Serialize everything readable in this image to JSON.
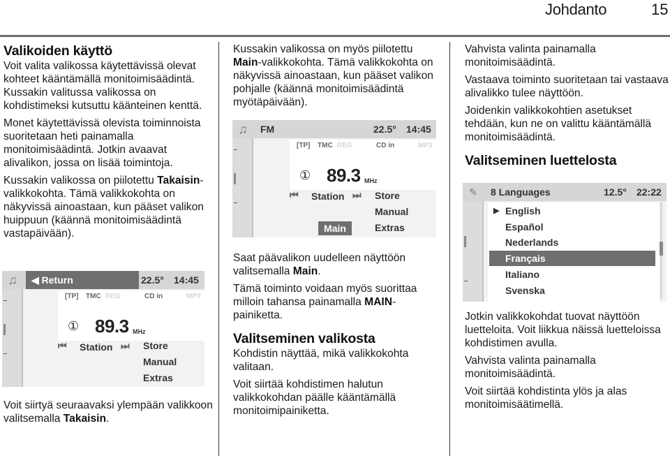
{
  "header": {
    "section": "Johdanto",
    "page_number": "15"
  },
  "col1": {
    "heading": "Valikoiden käyttö",
    "p1": "Voit valita valikossa käytettävissä olevat kohteet kääntämällä monitoimisäädintä. Kussakin valitussa valikossa on kohdistimeksi kutsuttu käänteinen kenttä.",
    "p2": "Monet käytettävissä olevista toiminnoista suoritetaan heti painamalla monitoimisäädintä. Jotkin avaavat alivalikon, jossa on lisää toimintoja.",
    "p3_pre": "Kussakin valikossa on piilotettu ",
    "p3_bold": "Takaisin",
    "p3_post": "-valikkokohta. Tämä valikkokohta on näkyvissä ainoastaan, kun pääset valikon huippuun (käännä monitoimisäädintä vastapäivään).",
    "p4_pre": "Voit siirtyä seuraavaksi ylempään valikkoon valitsemalla ",
    "p4_bold": "Takaisin",
    "p4_post": "."
  },
  "screen1": {
    "icon": "music-note-icon",
    "title": "◀ Return",
    "temperature": "22.5°",
    "time": "14:45",
    "indicators": [
      "[TP]",
      "TMC",
      "REG",
      "CD in",
      "MP3"
    ],
    "preset": "①",
    "frequency": "89.3",
    "unit": "MHz",
    "prev_glyph": "⏮",
    "station": "Station",
    "next_glyph": "⏭",
    "options": [
      "Store",
      "Manual",
      "Extras"
    ]
  },
  "col2": {
    "p1_pre": "Kussakin valikossa on myös piilotettu ",
    "p1_bold": "Main",
    "p1_post": "-valikkokohta. Tämä valikkokohta on näkyvissä ainoastaan, kun pääset valikon pohjalle (käännä monitoimisäädintä myötäpäivään).",
    "p2_pre": "Saat päävalikon uudelleen näyttöön valitsemalla ",
    "p2_bold": "Main",
    "p2_post": ".",
    "p3_pre": "Tämä toiminto voidaan myös suorittaa milloin tahansa painamalla ",
    "p3_bold": "MAIN",
    "p3_post": "-painiketta.",
    "heading": "Valitseminen valikosta",
    "p4": "Kohdistin näyttää, mikä valikkokohta valitaan.",
    "p5": "Voit siirtää kohdistimen halutun valikkokohdan päälle kääntämällä monitoimipainiketta."
  },
  "screen2": {
    "icon": "music-note-icon",
    "title": "FM",
    "temperature": "22.5°",
    "time": "14:45",
    "indicators": [
      "[TP]",
      "TMC",
      "REG",
      "CD in",
      "MP3"
    ],
    "preset": "①",
    "frequency": "89.3",
    "unit": "MHz",
    "prev_glyph": "⏮",
    "station": "Station",
    "next_glyph": "⏭",
    "options": [
      "Store",
      "Manual",
      "Extras"
    ],
    "main_button": "Main"
  },
  "col3": {
    "p1": "Vahvista valinta painamalla monitoimisäädintä.",
    "p2": "Vastaava toiminto suoritetaan tai vastaava alivalikko tulee näyttöön.",
    "p3": "Joidenkin valikkokohtien asetukset tehdään, kun ne on valittu kääntämällä monitoimisäädintä.",
    "heading": "Valitseminen luettelosta",
    "p4": "Jotkin valikkokohdat tuovat näyttöön luetteloita. Voit liikkua näissä luetteloissa kohdistimen avulla.",
    "p5": "Vahvista valinta painamalla monitoimisäädintä.",
    "p6": "Voit siirtää kohdistinta ylös ja alas monitoimisäätimellä."
  },
  "screen3": {
    "icon": "settings-wrench-icon",
    "title": "8 Languages",
    "temperature": "12.5°",
    "time": "22:22",
    "active_marker": "▶",
    "languages": [
      "English",
      "Español",
      "Nederlands",
      "Français",
      "Italiano",
      "Svenska"
    ],
    "active_language": "English",
    "selected_language": "Français"
  }
}
